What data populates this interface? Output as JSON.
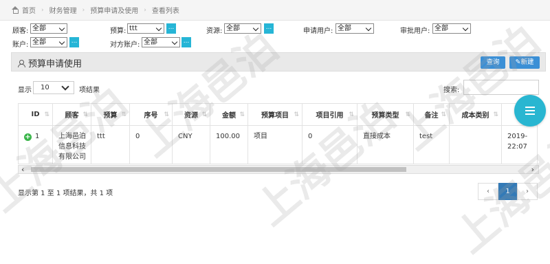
{
  "breadcrumb": {
    "items": [
      "首页",
      "财务管理",
      "预算申请及使用",
      "查看列表"
    ]
  },
  "filters": {
    "row1": [
      {
        "label": "顾客:",
        "value": "全部"
      },
      {
        "label": "预算:",
        "value": "ttt",
        "btn": "..."
      },
      {
        "label": "资源:",
        "value": "全部",
        "btn": "..."
      },
      {
        "label": "申请用户:",
        "value": "全部"
      },
      {
        "label": "审批用户:",
        "value": "全部"
      }
    ],
    "row2": [
      {
        "label": "账户:",
        "value": "全部",
        "btn": "..."
      },
      {
        "label": "对方账户:",
        "value": "全部",
        "btn": "..."
      }
    ]
  },
  "panel": {
    "title": "预算申请使用",
    "query_btn": "查询",
    "new_btn": "新建"
  },
  "length_menu": {
    "prefix": "显示",
    "value": "10",
    "suffix": "项结果"
  },
  "search": {
    "label": "搜索:"
  },
  "table": {
    "headers": [
      "ID",
      "顾客",
      "预算",
      "序号",
      "资源",
      "金额",
      "预算项目",
      "项目引用",
      "预算类型",
      "备注",
      "成本类别",
      ""
    ],
    "rows": [
      {
        "id": "1",
        "customer": "上海邑泊信息科技有限公司",
        "budget": "ttt",
        "seq": "0",
        "resource": "CNY",
        "amount": "100.00",
        "budget_item": "项目",
        "item_ref": "0",
        "budget_type": "直接成本",
        "remark": "test",
        "cost_category": "",
        "datetime": "2019-\n22:07"
      }
    ]
  },
  "footer": {
    "info": "显示第 1 至 1 项结果，共 1 项"
  },
  "pagination": {
    "prev": "‹",
    "current": "1",
    "next": "›"
  },
  "watermark": "上海邑泊",
  "colors": {
    "accent": "#3a8fd6",
    "cyan": "#26b5d6",
    "fab": "#29b6d1",
    "green": "#3ab54a"
  }
}
